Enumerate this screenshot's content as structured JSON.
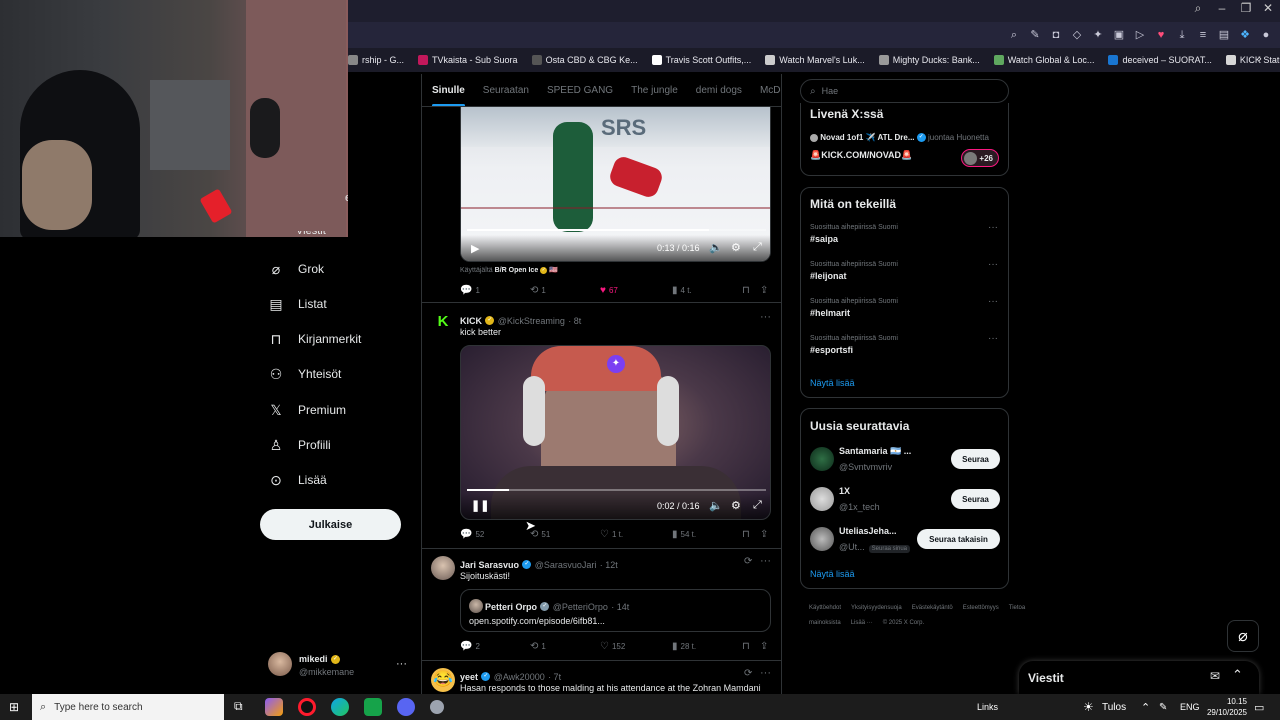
{
  "browser": {
    "bookmarks": [
      {
        "label": "rship - G...",
        "color": "#888888"
      },
      {
        "label": "TVkaista - Sub Suora",
        "color": "#c2185b"
      },
      {
        "label": "Osta CBD & CBG Ke...",
        "color": "#555555"
      },
      {
        "label": "Travis Scott Outfits,...",
        "color": "#ffffff"
      },
      {
        "label": "Watch Marvel's Luk...",
        "color": "#cccccc"
      },
      {
        "label": "Mighty Ducks: Bank...",
        "color": "#999999"
      },
      {
        "label": "Watch Global & Loc...",
        "color": "#5fa85f"
      },
      {
        "label": "deceived – SUORAT...",
        "color": "#1976d2"
      },
      {
        "label": "KICK Status Page",
        "color": "#d6d6d6"
      }
    ]
  },
  "webcam": {
    "partial_text": "et"
  },
  "nav": {
    "partial_item": "Viestit",
    "items": [
      {
        "label": "Grok",
        "icon": "grok-icon"
      },
      {
        "label": "Listat",
        "icon": "list-icon"
      },
      {
        "label": "Kirjanmerkit",
        "icon": "bookmark-icon"
      },
      {
        "label": "Yhteisöt",
        "icon": "communities-icon"
      },
      {
        "label": "Premium",
        "icon": "x-logo-icon"
      },
      {
        "label": "Profiili",
        "icon": "profile-icon"
      },
      {
        "label": "Lisää",
        "icon": "more-circle-icon"
      }
    ],
    "post_button": "Julkaise",
    "account": {
      "name": "mikedi",
      "handle": "@mikkemane",
      "menu": "···"
    }
  },
  "feed": {
    "tabs": [
      "Sinulle",
      "Seuraatan",
      "SPEED GANG",
      "The jungle",
      "demi dogs",
      "McDonal"
    ],
    "active_tab": 0,
    "post1": {
      "video_time": "0:13 / 0:16",
      "video_progress": 0.81,
      "attribution_prefix": "Käyttäjältä",
      "attribution_name": "B/R Open Ice",
      "attribution_suffix": "🇺🇸",
      "replies": "1",
      "reposts": "1",
      "likes": "67",
      "views": "4 t."
    },
    "post2": {
      "author": "KICK",
      "handle": "@KickStreaming",
      "time": "· 8t",
      "text": "kick better",
      "video_time": "0:02 / 0:16",
      "video_progress": 0.14,
      "replies": "52",
      "reposts": "51",
      "likes": "1 t.",
      "views": "54 t."
    },
    "post3": {
      "author": "Jari Sarasvuo",
      "handle": "@SarasvuoJari",
      "time": "· 12t",
      "text": "Sijoituskästi!",
      "quote_author": "Petteri Orpo",
      "quote_handle": "@PetteriOrpo",
      "quote_time": "· 14t",
      "quote_text": "open.spotify.com/episode/6ifb81...",
      "replies": "2",
      "reposts": "1",
      "likes": "152",
      "views": "28 t."
    },
    "post4": {
      "author": "yeet",
      "handle": "@Awk20000",
      "time": "· 7t",
      "text": "Hasan responds to those malding at his attendance at the Zohran Mamdani"
    }
  },
  "sidebar": {
    "search_placeholder": "Hae",
    "live": {
      "title": "Livenä X:ssä",
      "host": "Novad 1of1 ✈️ ATL Dre...",
      "host_role": "juontaa Huonetta",
      "room": "🚨KICK.COM/NOVAD🚨",
      "listeners": "+26"
    },
    "trends": {
      "title": "Mitä on tekeillä",
      "items": [
        {
          "context": "Suosittua aihepiirissä Suomi",
          "tag": "#saipa"
        },
        {
          "context": "Suosittua aihepiirissä Suomi",
          "tag": "#leijonat"
        },
        {
          "context": "Suosittua aihepiirissä Suomi",
          "tag": "#helmarit"
        },
        {
          "context": "Suosittua aihepiirissä Suomi",
          "tag": "#esportsfi"
        }
      ],
      "show_more": "Näytä lisää"
    },
    "follow": {
      "title": "Uusia seurattavia",
      "items": [
        {
          "name": "Santamaria 🇦🇷 ...",
          "handle": "@Svntvmvriv",
          "button": "Seuraa"
        },
        {
          "name": "1X",
          "handle": "@1x_tech",
          "button": "Seuraa"
        },
        {
          "name": "UteliasJeha...",
          "handle": "@Ut...",
          "badge": "Seuraa sinua",
          "button": "Seuraa takaisin"
        }
      ],
      "show_more": "Näytä lisää"
    },
    "footer": {
      "links": [
        "Käyttöehdot",
        "Yksityisyydensuoja",
        "Evästekäytäntö",
        "Esteettömyys",
        "Tietoa mainoksista",
        "Lisää ···"
      ],
      "copyright": "© 2025 X Corp."
    }
  },
  "messages_drawer": {
    "title": "Viestit"
  },
  "taskbar": {
    "search_placeholder": "Type here to search",
    "links_label": "Links",
    "weather": "Tulos",
    "language": "ENG",
    "time": "10.15",
    "date": "29/10/2025"
  },
  "colors": {
    "accent": "#1d9bf0",
    "like": "#f91880",
    "kick": "#53fc18"
  }
}
